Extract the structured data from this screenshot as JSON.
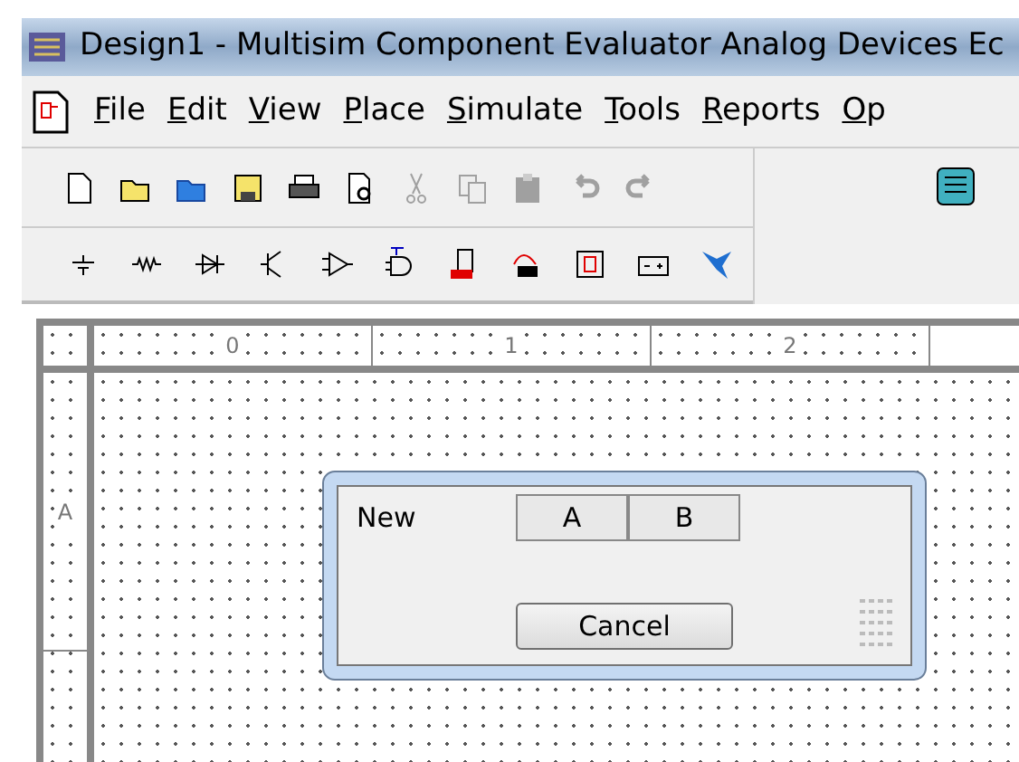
{
  "window": {
    "title": "Design1 - Multisim Component Evaluator Analog Devices Ec"
  },
  "menu": [
    {
      "label": "File"
    },
    {
      "label": "Edit"
    },
    {
      "label": "View"
    },
    {
      "label": "Place"
    },
    {
      "label": "Simulate"
    },
    {
      "label": "Tools"
    },
    {
      "label": "Reports"
    },
    {
      "label": "Op"
    }
  ],
  "toolbar_main": [
    {
      "kind": "new",
      "disabled": false
    },
    {
      "kind": "open",
      "disabled": false
    },
    {
      "kind": "open-sample",
      "disabled": false
    },
    {
      "kind": "save",
      "disabled": false
    },
    {
      "kind": "print",
      "disabled": false
    },
    {
      "kind": "preview",
      "disabled": false
    },
    {
      "kind": "cut",
      "disabled": true
    },
    {
      "kind": "copy",
      "disabled": true
    },
    {
      "kind": "paste",
      "disabled": true
    },
    {
      "kind": "undo",
      "disabled": true
    },
    {
      "kind": "redo",
      "disabled": true
    }
  ],
  "toolbar_components": [
    {
      "kind": "source"
    },
    {
      "kind": "resistor"
    },
    {
      "kind": "diode"
    },
    {
      "kind": "transistor"
    },
    {
      "kind": "opamp"
    },
    {
      "kind": "ttl"
    },
    {
      "kind": "digital"
    },
    {
      "kind": "mixed"
    },
    {
      "kind": "indicator"
    },
    {
      "kind": "power"
    },
    {
      "kind": "wizard"
    }
  ],
  "ruler": {
    "columns": [
      "0",
      "1",
      "2"
    ],
    "rows": [
      "A"
    ]
  },
  "dialog": {
    "label": "New",
    "tabs": [
      {
        "label": "A",
        "selected": false
      },
      {
        "label": "B",
        "selected": false
      }
    ],
    "cancel": "Cancel"
  }
}
